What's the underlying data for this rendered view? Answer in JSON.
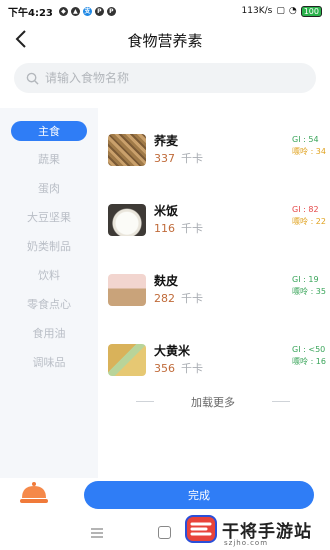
{
  "status_bar": {
    "time": "下午4:23",
    "network_speed": "113K/s",
    "battery": "100"
  },
  "header": {
    "title": "食物营养素"
  },
  "search": {
    "placeholder": "请输入食物名称"
  },
  "categories": [
    {
      "label": "主食",
      "active": true
    },
    {
      "label": "蔬果",
      "active": false
    },
    {
      "label": "蛋肉",
      "active": false
    },
    {
      "label": "大豆坚果",
      "active": false
    },
    {
      "label": "奶类制品",
      "active": false
    },
    {
      "label": "饮料",
      "active": false
    },
    {
      "label": "零食点心",
      "active": false
    },
    {
      "label": "食用油",
      "active": false
    },
    {
      "label": "调味品",
      "active": false
    }
  ],
  "foods": [
    {
      "name": "荞麦",
      "kcal": "337",
      "unit": "千卡",
      "gi": "GI : 54",
      "gi_level": "嘌呤 : 34",
      "gi_color": "#3aa55a",
      "gi_level_color": "#e0a320"
    },
    {
      "name": "米饭",
      "kcal": "116",
      "unit": "千卡",
      "gi": "GI : 82",
      "gi_level": "嘌呤 : 22",
      "gi_color": "#e54848",
      "gi_level_color": "#e0a320"
    },
    {
      "name": "麸皮",
      "kcal": "282",
      "unit": "千卡",
      "gi": "GI : 19",
      "gi_level": "嘌呤 : 35",
      "gi_color": "#3aa55a",
      "gi_level_color": "#3aa55a"
    },
    {
      "name": "大黄米",
      "kcal": "356",
      "unit": "千卡",
      "gi": "GI : <50",
      "gi_level": "嘌呤 : 16",
      "gi_color": "#3aa55a",
      "gi_level_color": "#3aa55a"
    }
  ],
  "load_more": "加载更多",
  "done_button": "完成",
  "watermark": {
    "text": "干将手游站",
    "sub": "szjho.com"
  },
  "colors": {
    "accent": "#2f7df6",
    "kcal": "#c06b3a"
  }
}
